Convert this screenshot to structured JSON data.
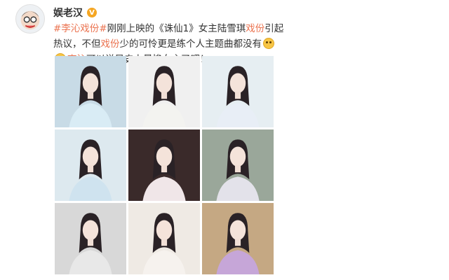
{
  "user": {
    "name": "娱老汉",
    "verified_badge": "V"
  },
  "post": {
    "line1_hashtag": "#李沁戏份#",
    "line1_text_a": "刚刚上映的《诛仙1》女主陆雪琪",
    "line1_hl": "戏份",
    "line1_text_b": "引起热议，不但",
    "line1_hl2": "戏份",
    "line1_text_c": "少的可怜更是练个人主",
    "line2_text_a": "题曲都没有",
    "line2_mention": "李沁",
    "line2_text_b": "可以说是史上最惨女主了吧！"
  },
  "icons": {
    "emoji_1": "grin-emoji",
    "emoji_2": "sad-emoji"
  },
  "photos": [
    {
      "name": "photo-1",
      "bg": "#c8dbe6",
      "cloth": "#d9ecf5"
    },
    {
      "name": "photo-2",
      "bg": "#f0f0f0",
      "cloth": "#f3f3f0"
    },
    {
      "name": "photo-3",
      "bg": "#e6eef2",
      "cloth": "#e8eef6"
    },
    {
      "name": "photo-4",
      "bg": "#dde9ef",
      "cloth": "#cfe3ef"
    },
    {
      "name": "photo-5",
      "bg": "#3a2a2a",
      "cloth": "#f0e6e8"
    },
    {
      "name": "photo-6",
      "bg": "#9aa79a",
      "cloth": "#e3e2ea"
    },
    {
      "name": "photo-7",
      "bg": "#d8d8d8",
      "cloth": "#e8e8e8"
    },
    {
      "name": "photo-8",
      "bg": "#efeae4",
      "cloth": "#f6f2ee"
    },
    {
      "name": "photo-9",
      "bg": "#c5a883",
      "cloth": "#c6a6d8"
    }
  ]
}
